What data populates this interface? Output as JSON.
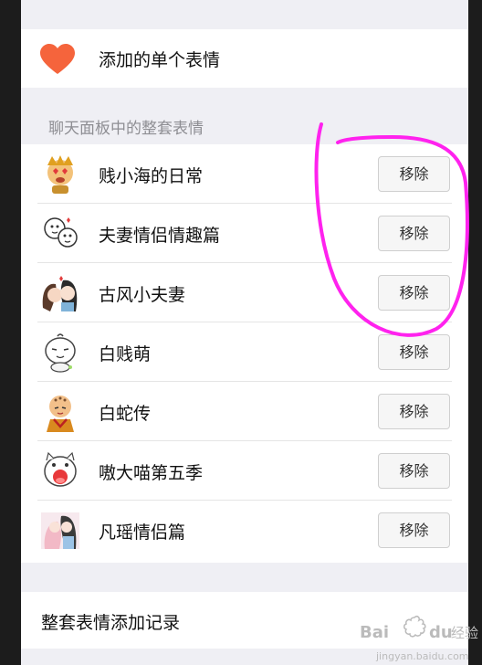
{
  "single_emoji": {
    "label": "添加的单个表情",
    "icon": "heart-icon",
    "icon_color": "#f5643c"
  },
  "chat_panel": {
    "header": "聊天面板中的整套表情",
    "packs": [
      {
        "name": "贱小海的日常",
        "remove_label": "移除"
      },
      {
        "name": "夫妻情侣情趣篇",
        "remove_label": "移除"
      },
      {
        "name": "古风小夫妻",
        "remove_label": "移除"
      },
      {
        "name": "白贱萌",
        "remove_label": "移除"
      },
      {
        "name": "白蛇传",
        "remove_label": "移除"
      },
      {
        "name": "嗷大喵第五季",
        "remove_label": "移除"
      },
      {
        "name": "凡瑶情侣篇",
        "remove_label": "移除"
      }
    ]
  },
  "history": {
    "label": "整套表情添加记录"
  },
  "annotation_color": "#ff22ee",
  "watermark": {
    "logo": "Bai du",
    "text": "经验",
    "url": "jingyan.baidu.com"
  }
}
